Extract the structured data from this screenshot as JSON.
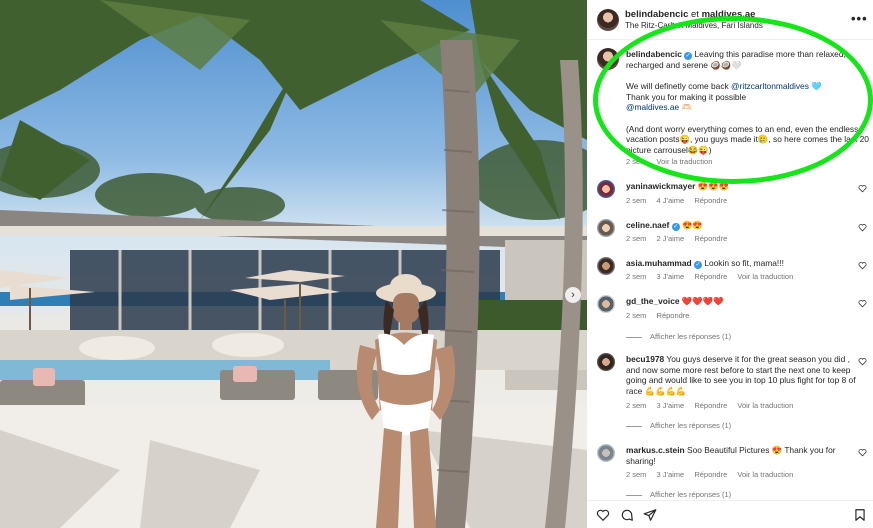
{
  "post": {
    "username": "belindabencic",
    "separator": "et",
    "coauthor": "maldives.ae",
    "location": "The Ritz-Carlton Maldives, Fari Islands",
    "more_label": "•••",
    "next_label": "›"
  },
  "caption": {
    "username": "belindabencic",
    "text_1": "Leaving this paradise more than relaxed, recharged and serene 🥥🥥🤍",
    "text_2": "We will definetly come back",
    "mention_1": "@ritzcarltonmaldives",
    "text_2_emoji": "🩵",
    "text_3": "Thank you for making it possible",
    "mention_2": "@maldives.ae",
    "text_3_emoji": "🫶🏻",
    "text_4": "(And dont worry everything comes to an end, even the endless vacation posts😜, you guys made it🥲, so here comes the last 20 picture carrousel😂😜)",
    "time": "2 sem",
    "translate": "Voir la traduction"
  },
  "comments": [
    {
      "username": "yaninawickmayer",
      "text": "😍😍😍",
      "time": "2 sem",
      "likes": "4 J'aime",
      "reply": "Répondre",
      "translate": "",
      "replies": ""
    },
    {
      "username": "celine.naef",
      "verified": true,
      "text": "😍😍",
      "time": "2 sem",
      "likes": "2 J'aime",
      "reply": "Répondre",
      "translate": "",
      "replies": ""
    },
    {
      "username": "asia.muhammad",
      "verified": true,
      "text": "Lookin so fit, mama!!!",
      "time": "2 sem",
      "likes": "3 J'aime",
      "reply": "Répondre",
      "translate": "Voir la traduction",
      "replies": ""
    },
    {
      "username": "gd_the_voice",
      "text": "❤️❤️❤️❤️",
      "time": "2 sem",
      "likes": "",
      "reply": "Répondre",
      "translate": "",
      "replies": "Afficher les réponses (1)"
    },
    {
      "username": "becu1978",
      "text": "You guys deserve it for the great season you did , and now some more rest before to start the next one to keep going and would like to see you in top 10 plus fight for top 8 of race 💪💪💪💪",
      "time": "2 sem",
      "likes": "3 J'aime",
      "reply": "Répondre",
      "translate": "Voir la traduction",
      "replies": "Afficher les réponses (1)"
    },
    {
      "username": "markus.c.stein",
      "text": "Soo Beautiful Pictures 😍 Thank you for sharing!",
      "time": "2 sem",
      "likes": "3 J'aime",
      "reply": "Répondre",
      "translate": "Voir la traduction",
      "replies": "Afficher les réponses (1)"
    }
  ],
  "icons": {
    "like": "heart-icon",
    "comment": "comment-icon",
    "share": "share-icon",
    "save": "bookmark-icon",
    "verified_color": "#3897f0",
    "highlight_color": "#16e51a"
  }
}
